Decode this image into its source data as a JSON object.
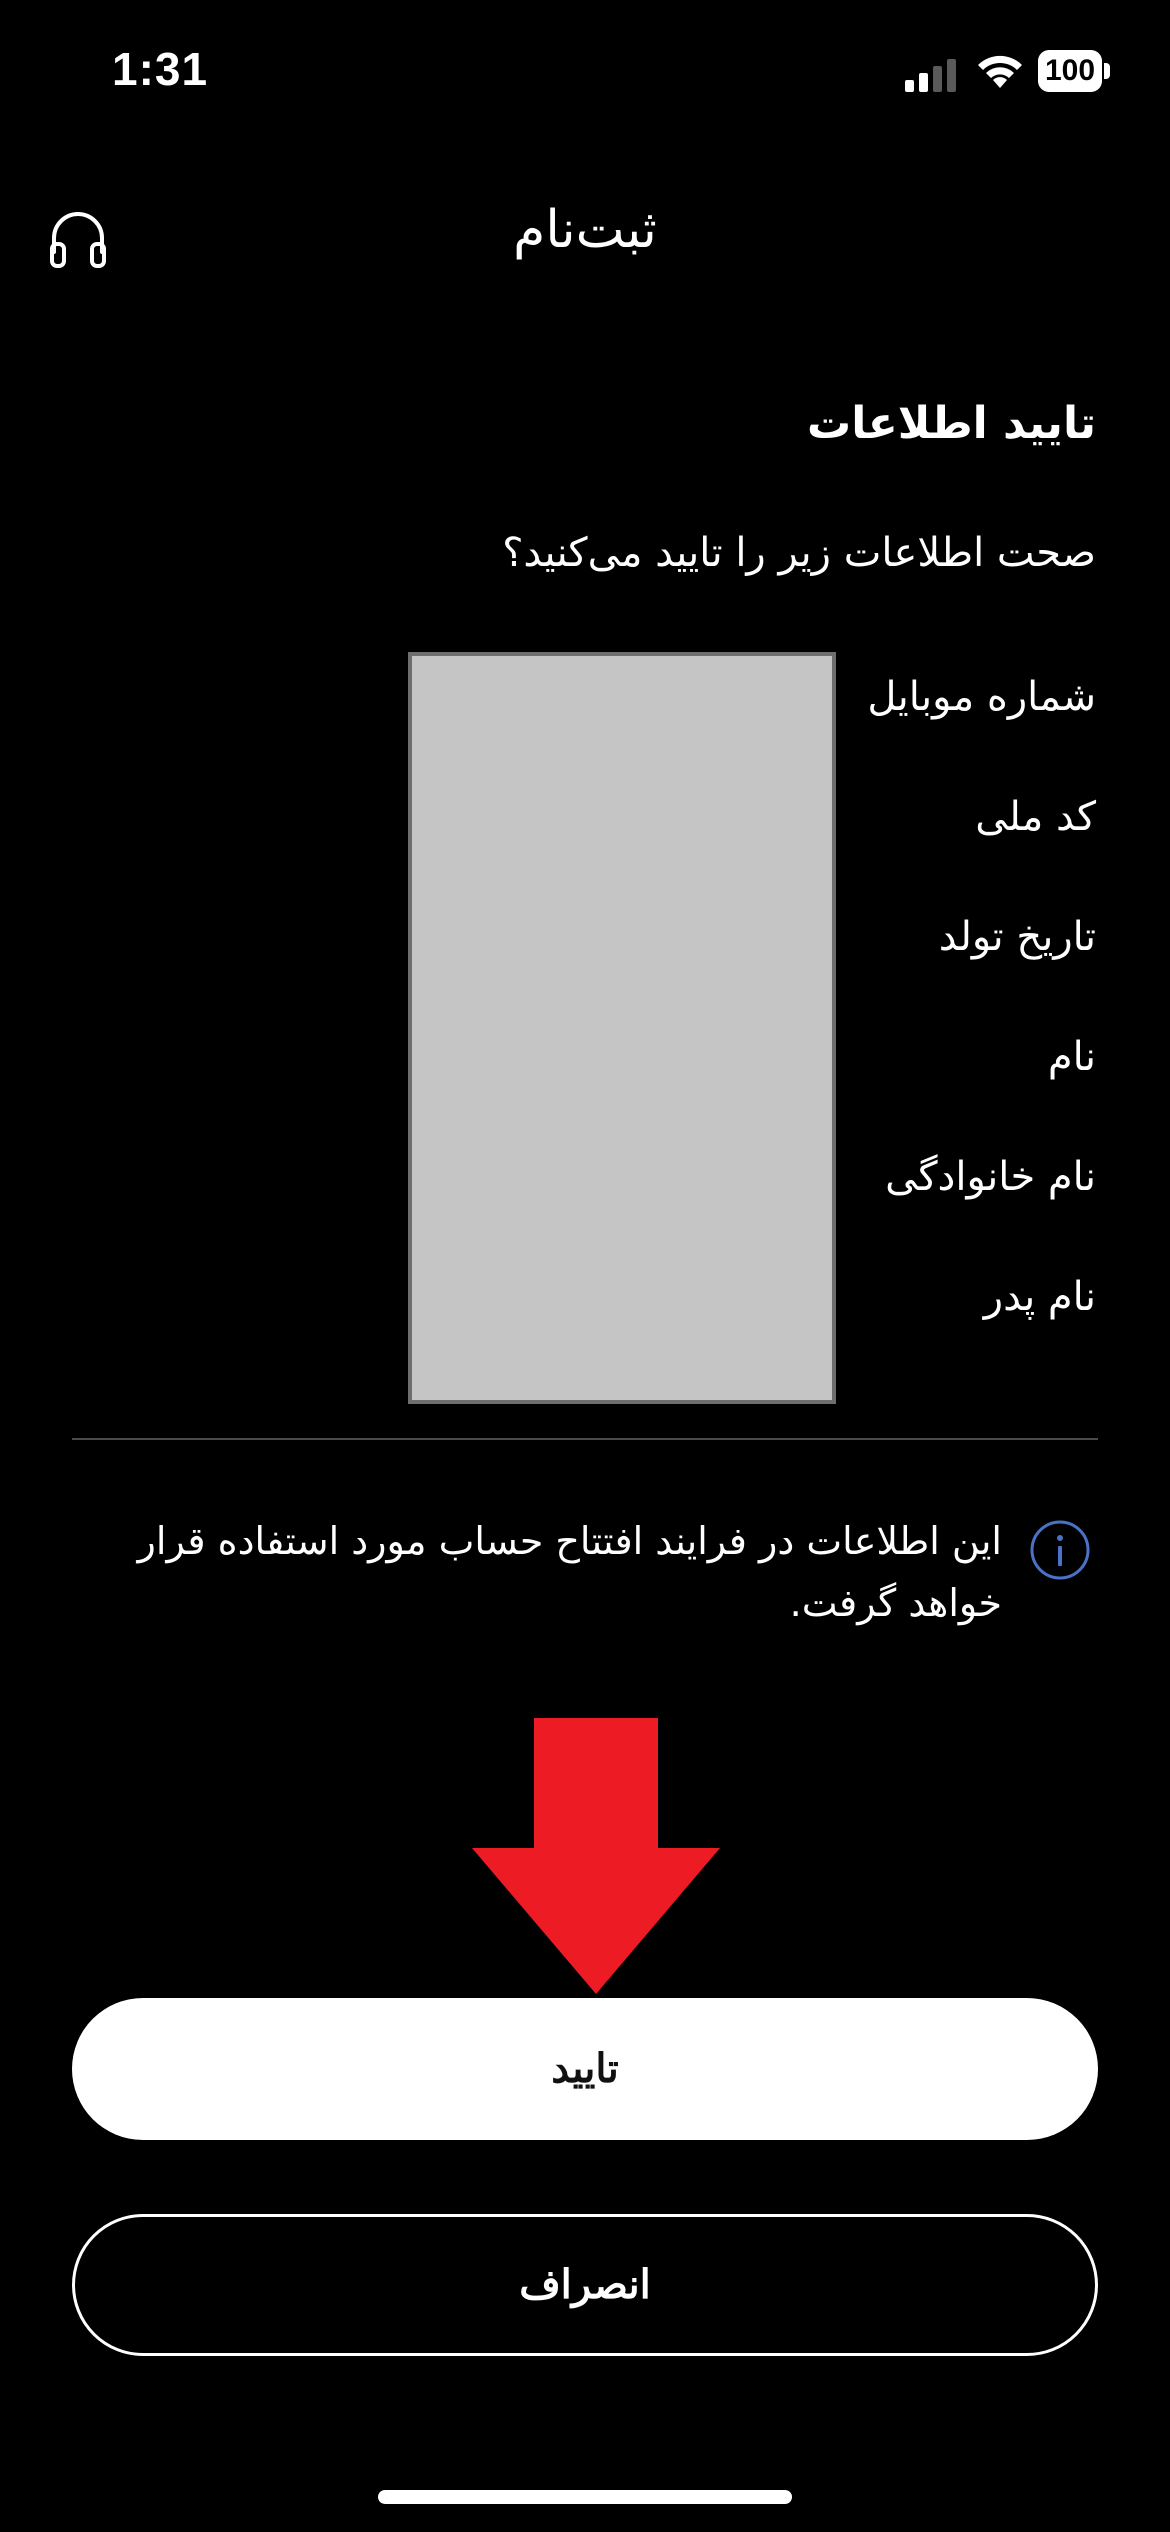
{
  "status_bar": {
    "time": "1:31",
    "battery": "100"
  },
  "header": {
    "title": "ثبت‌نام",
    "support_icon": "headphones-icon"
  },
  "content": {
    "section_title": "تایید اطلاعات",
    "question": "صحت اطلاعات زیر را تایید می‌کنید؟",
    "fields": [
      "شماره موبایل",
      "کد ملی",
      "تاریخ تولد",
      "نام",
      "نام خانوادگی",
      "نام پدر"
    ],
    "info_text": "این اطلاعات در فرایند افتتاح حساب مورد استفاده قرار خواهد گرفت.",
    "info_icon": "info-icon"
  },
  "actions": {
    "confirm_label": "تایید",
    "cancel_label": "انصراف"
  },
  "colors": {
    "background": "#000000",
    "arrow": "#ed1c24",
    "info_icon": "#4a72c9",
    "redaction": "#c5c5c5"
  }
}
